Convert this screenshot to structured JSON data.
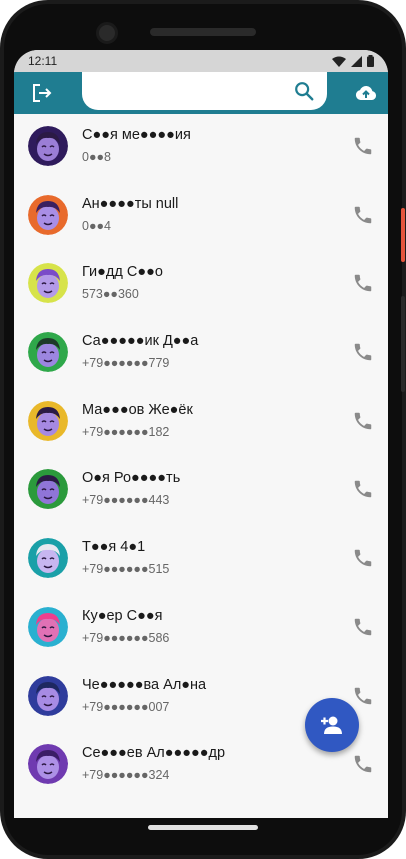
{
  "status_bar": {
    "time": "12:11"
  },
  "app_bar": {
    "search": {
      "value": "",
      "placeholder": ""
    },
    "colors": {
      "primary": "#1f7d91",
      "fab": "#3058c2"
    },
    "icons": {
      "logout": "logout-icon",
      "search": "search-icon",
      "upload": "cloud-upload-icon"
    }
  },
  "contacts": [
    {
      "name": "С●●я ме●●●●ия",
      "phone": "0●●8"
    },
    {
      "name": "Ан●●●●ты null",
      "phone": "0●●4"
    },
    {
      "name": "Ги●дд С●●о",
      "phone": "573●●360"
    },
    {
      "name": "Са●●●●●ик Д●●а",
      "phone": "+79●●●●●●779"
    },
    {
      "name": "Ма●●●ов Же●ёк",
      "phone": "+79●●●●●●182"
    },
    {
      "name": "О●я Ро●●●●ть",
      "phone": "+79●●●●●●443"
    },
    {
      "name": "Т●●я 4●1",
      "phone": "+79●●●●●●515"
    },
    {
      "name": "Ку●ер С●●я",
      "phone": "+79●●●●●●586"
    },
    {
      "name": "Че●●●●●ва Ал●на",
      "phone": "+79●●●●●●007"
    },
    {
      "name": "Се●●●ев Ал●●●●●др",
      "phone": "+79●●●●●●324"
    }
  ],
  "fab": {
    "icon": "add-person-icon"
  }
}
